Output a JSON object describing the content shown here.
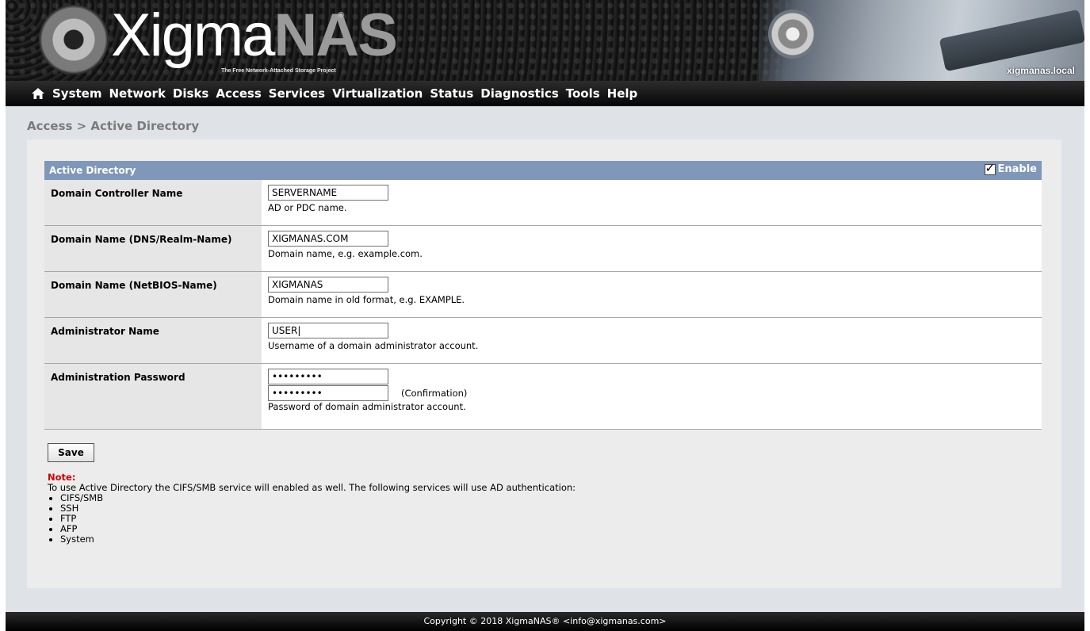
{
  "header": {
    "logo_text_main": "Xigma",
    "logo_text_accent": "NAS",
    "logo_registered": "®",
    "tagline": "The Free Network-Attached Storage Project",
    "hostname": "xigmanas.local"
  },
  "menu": {
    "home_icon": "home-icon",
    "items": [
      "System",
      "Network",
      "Disks",
      "Access",
      "Services",
      "Virtualization",
      "Status",
      "Diagnostics",
      "Tools",
      "Help"
    ]
  },
  "breadcrumb": "Access > Active Directory",
  "section": {
    "title": "Active Directory",
    "enable_label": "Enable",
    "enable_checked": true
  },
  "form": {
    "dc_name": {
      "label": "Domain Controller Name",
      "value": "SERVERNAME",
      "hint": "AD or PDC name."
    },
    "dns_name": {
      "label": "Domain Name (DNS/Realm-Name)",
      "value": "XIGMANAS.COM",
      "hint": "Domain name, e.g. example.com."
    },
    "netbios_name": {
      "label": "Domain Name (NetBIOS-Name)",
      "value": "XIGMANAS",
      "hint": "Domain name in old format, e.g. EXAMPLE."
    },
    "admin_name": {
      "label": "Administrator Name",
      "value": "USER|",
      "hint": "Username of a domain administrator account."
    },
    "admin_password": {
      "label": "Administration Password",
      "value": "•••••••••",
      "confirm_value": "•••••••••",
      "confirm_label": "(Confirmation)",
      "hint": "Password of domain administrator account."
    }
  },
  "save_label": "Save",
  "note": {
    "title": "Note:",
    "text": "To use Active Directory the CIFS/SMB service will enabled as well. The following services will use AD authentication:",
    "items": [
      "CIFS/SMB",
      "SSH",
      "FTP",
      "AFP",
      "System"
    ]
  },
  "footer": "Copyright © 2018 XigmaNAS® <info@xigmanas.com>",
  "colors": {
    "section_header": "#7f97b8",
    "note_title": "#cc0000",
    "content_bg": "#dfe3e8"
  }
}
